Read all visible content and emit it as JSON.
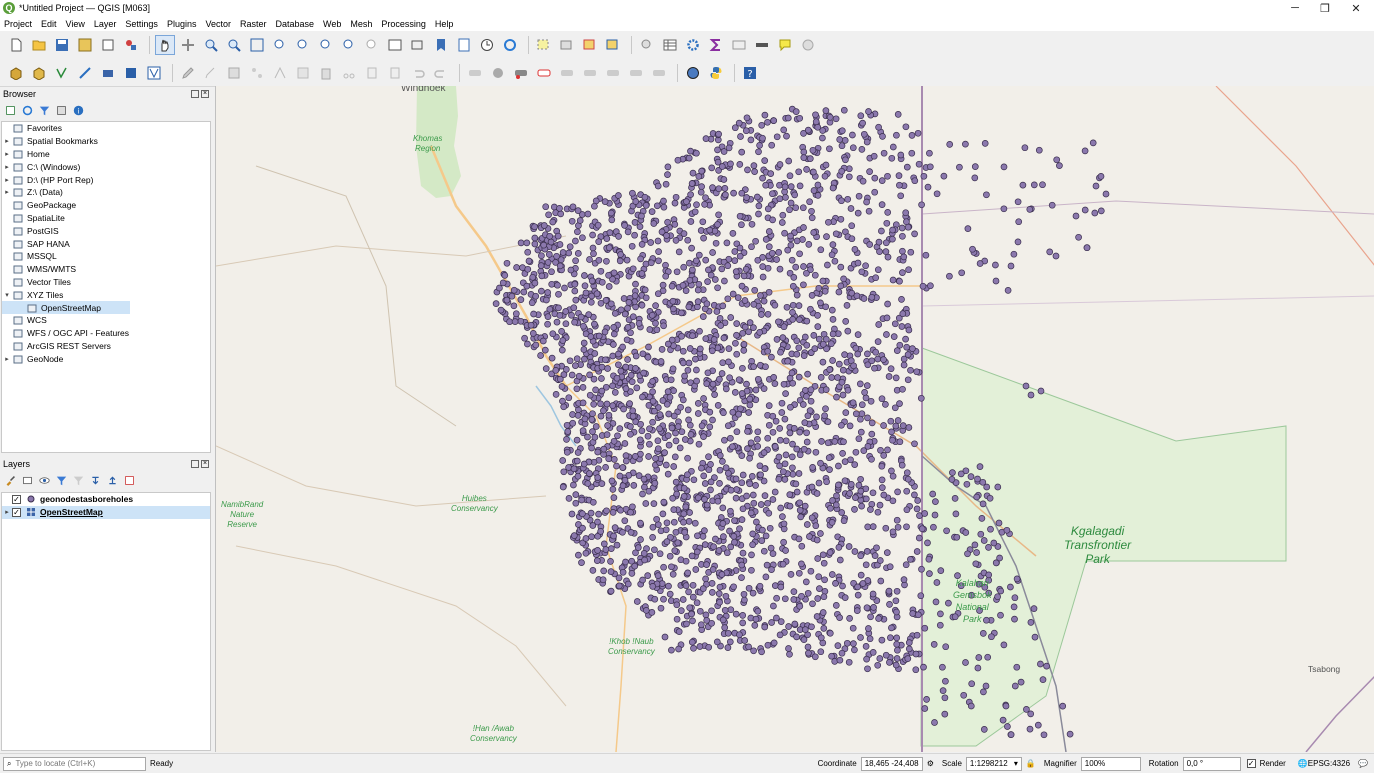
{
  "window": {
    "title": "*Untitled Project — QGIS [M063]",
    "minimize": "─",
    "restore": "❐",
    "close": "✕"
  },
  "menu": [
    "Project",
    "Edit",
    "View",
    "Layer",
    "Settings",
    "Plugins",
    "Vector",
    "Raster",
    "Database",
    "Web",
    "Mesh",
    "Processing",
    "Help"
  ],
  "browser": {
    "title": "Browser",
    "items": [
      {
        "label": "Favorites",
        "icon": "star-icon",
        "expand": ""
      },
      {
        "label": "Spatial Bookmarks",
        "icon": "bookmark-icon",
        "expand": "▸"
      },
      {
        "label": "Home",
        "icon": "home-folder-icon",
        "expand": "▸"
      },
      {
        "label": "C:\\ (Windows)",
        "icon": "folder-icon",
        "expand": "▸"
      },
      {
        "label": "D:\\ (HP Port Rep)",
        "icon": "folder-icon",
        "expand": "▸"
      },
      {
        "label": "Z:\\ (Data)",
        "icon": "folder-icon",
        "expand": "▸"
      },
      {
        "label": "GeoPackage",
        "icon": "geopackage-icon",
        "expand": ""
      },
      {
        "label": "SpatiaLite",
        "icon": "spatialite-icon",
        "expand": ""
      },
      {
        "label": "PostGIS",
        "icon": "postgis-icon",
        "expand": ""
      },
      {
        "label": "SAP HANA",
        "icon": "hana-icon",
        "expand": ""
      },
      {
        "label": "MSSQL",
        "icon": "mssql-icon",
        "expand": ""
      },
      {
        "label": "WMS/WMTS",
        "icon": "globe-icon",
        "expand": ""
      },
      {
        "label": "Vector Tiles",
        "icon": "grid-icon",
        "expand": ""
      },
      {
        "label": "XYZ Tiles",
        "icon": "grid-icon",
        "expand": "▾"
      },
      {
        "label": "OpenStreetMap",
        "icon": "grid-icon",
        "expand": "",
        "child": true,
        "selected": true
      },
      {
        "label": "WCS",
        "icon": "globe-icon",
        "expand": ""
      },
      {
        "label": "WFS / OGC API - Features",
        "icon": "wfs-icon",
        "expand": ""
      },
      {
        "label": "ArcGIS REST Servers",
        "icon": "arcgis-icon",
        "expand": ""
      },
      {
        "label": "GeoNode",
        "icon": "geonode-icon",
        "expand": "▸"
      }
    ]
  },
  "layers": {
    "title": "Layers",
    "items": [
      {
        "label": "geonodestasboreholes",
        "checked": "✓",
        "expand": "",
        "icon": "point-layer-icon"
      },
      {
        "label": "OpenStreetMap",
        "checked": "✓",
        "expand": "▸",
        "icon": "raster-layer-icon",
        "selected": true
      }
    ]
  },
  "map_labels": {
    "windhoek": "Windhoek",
    "khomas": "Khomas\nRegion",
    "namibrand": "NamibRand\nNature\nReserve",
    "huibes": "Huibes\nConservancy",
    "khob": "!Khob !Naub\nConservancy",
    "han": "!Han /Awab\nConservancy",
    "kgalagadi": "Kgalagadi\nTransfrontier\nPark",
    "kalahari": "Kalahari\nGemsbok\nNational\nPark",
    "tsabong": "Tsabong"
  },
  "colors": {
    "point_fill": "#8b78ad",
    "point_stroke": "#3a2e4d",
    "map_bg": "#f2efe9",
    "road": "#f5c98a",
    "border": "#a88ab0",
    "park": "#cfe8bf"
  },
  "status": {
    "locate_placeholder": "Type to locate (Ctrl+K)",
    "ready": "Ready",
    "coordinate_label": "Coordinate",
    "coordinate_value": "18,465 -24,408",
    "scale_label": "Scale",
    "scale_value": "1:1298212",
    "magnifier_label": "Magnifier",
    "magnifier_value": "100%",
    "rotation_label": "Rotation",
    "rotation_value": "0,0 °",
    "render_label": "Render",
    "crs": "EPSG:4326"
  }
}
